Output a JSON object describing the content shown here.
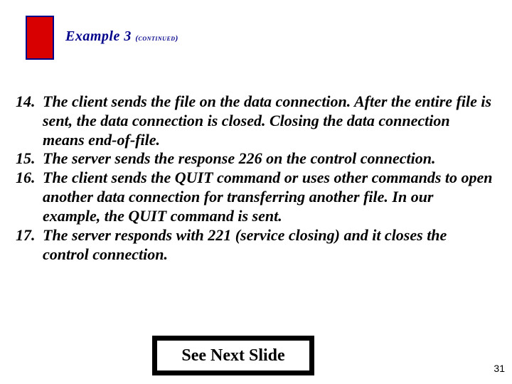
{
  "title": {
    "main": "Example 3 ",
    "sub": "(continued)"
  },
  "items": [
    {
      "num": "14.",
      "text": "The client sends the file on the data connection. After the entire file is sent, the data connection is closed. Closing the data connection means end-of-file."
    },
    {
      "num": "15.",
      "text": "The server sends the response 226 on the control connection."
    },
    {
      "num": "16.",
      "text": "The client sends the QUIT command or uses other commands to open another data connection for transferring another file. In our example, the QUIT command is sent."
    },
    {
      "num": "17.",
      "text": "The server responds with 221 (service closing) and it closes the control connection."
    }
  ],
  "cta": "See Next Slide",
  "page_number": "31"
}
